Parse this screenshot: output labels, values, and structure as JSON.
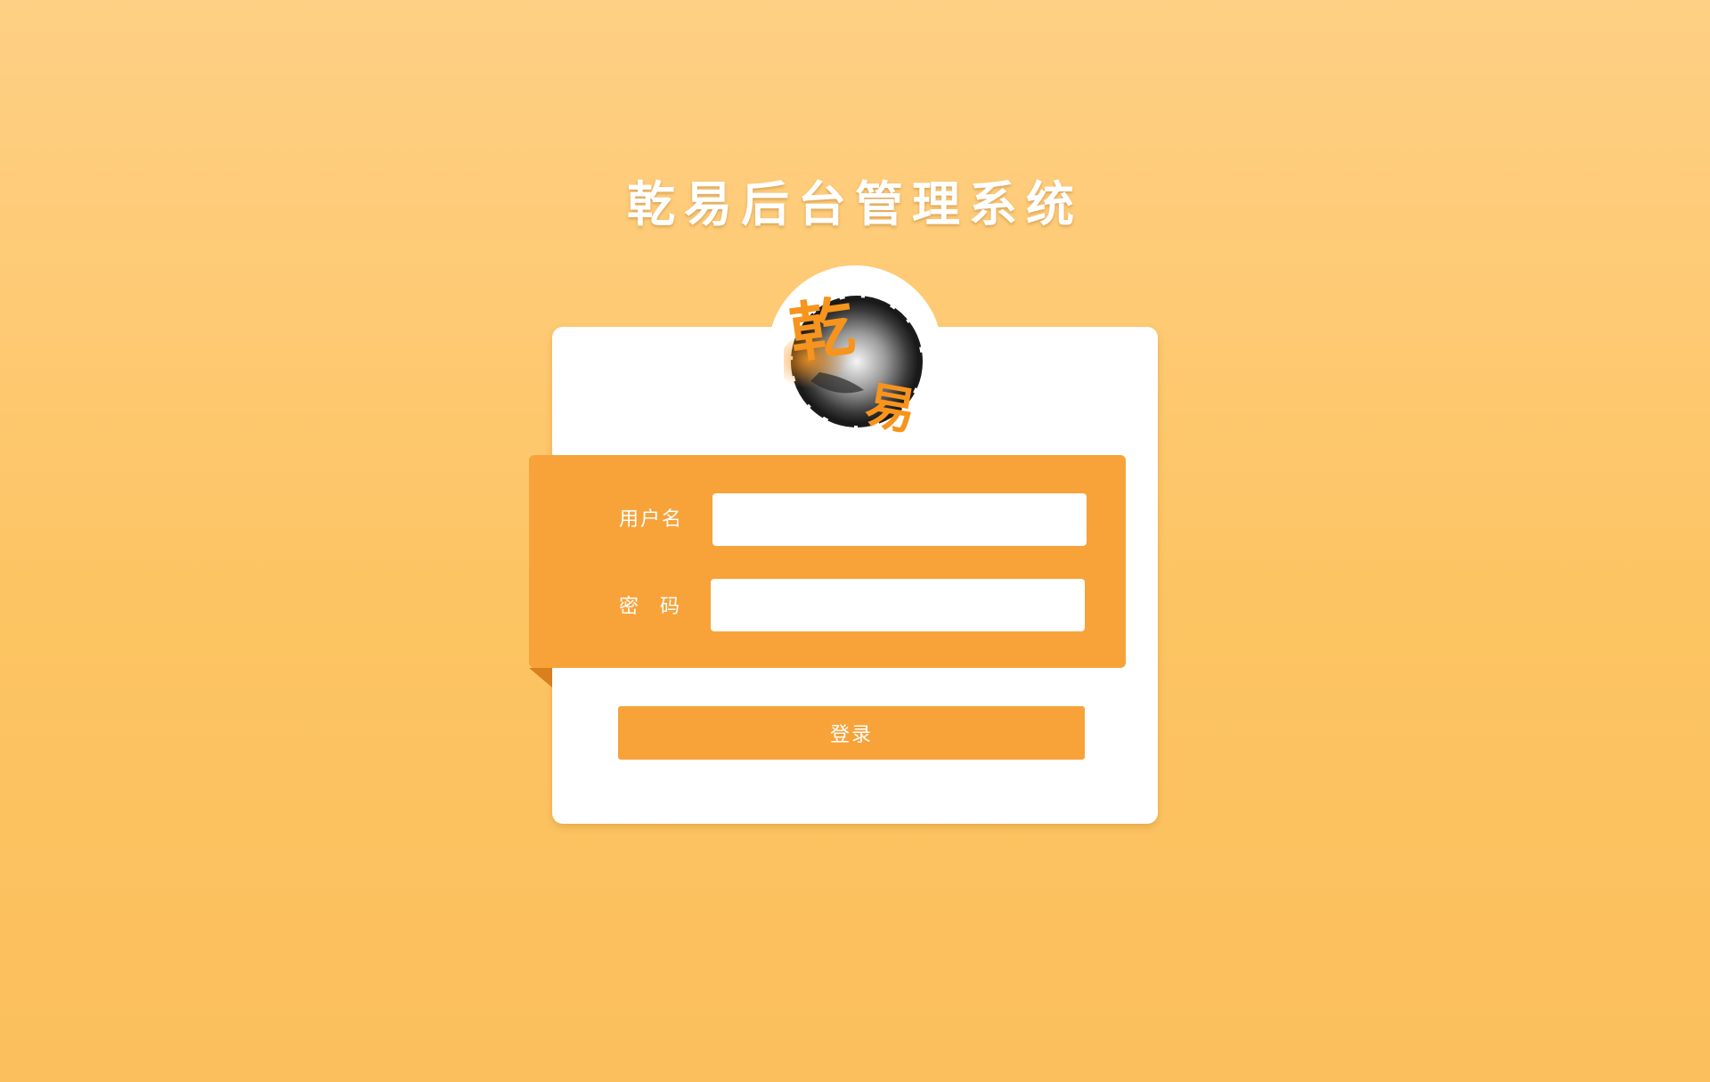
{
  "page": {
    "title": "乾易后台管理系统"
  },
  "logo": {
    "char_top": "乾",
    "char_bottom": "易",
    "icon": "ink-circle-logo-icon",
    "accent_color": "#f7941d"
  },
  "form": {
    "username_label": "用户名",
    "password_label_first": "密",
    "password_label_second": "码",
    "username_value": "",
    "password_value": "",
    "username_placeholder": "",
    "password_placeholder": ""
  },
  "login_button": {
    "label": "登录"
  },
  "colors": {
    "background_top": "#fed085",
    "background_bottom": "#fbbf5d",
    "ribbon": "#f7a33a",
    "ribbon_fold": "#d97f1c",
    "button": "#f7a33a"
  }
}
